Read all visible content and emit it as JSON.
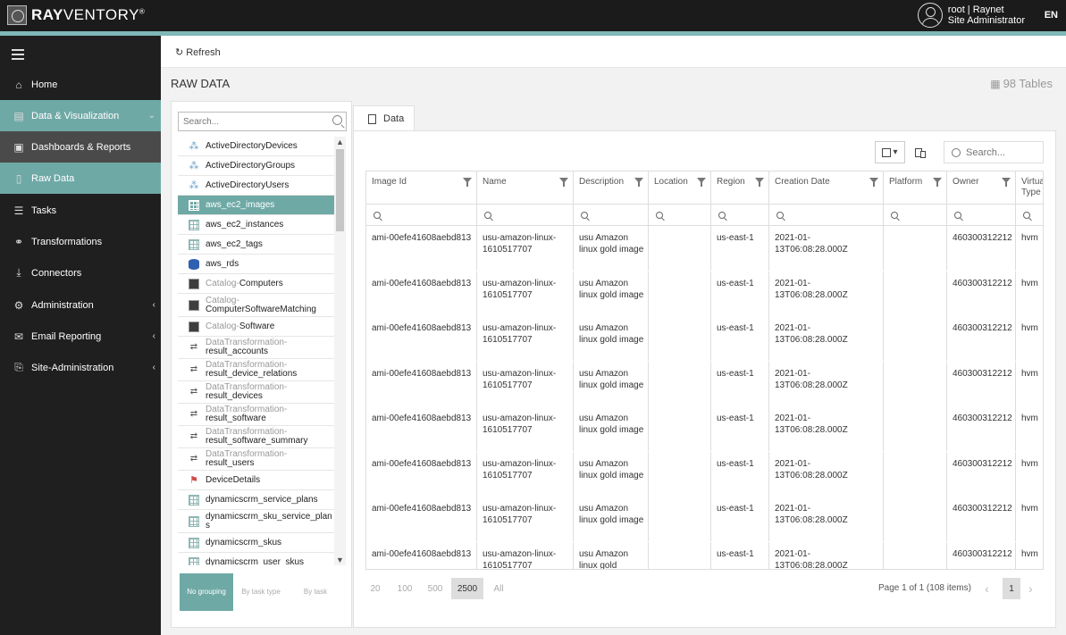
{
  "app": {
    "brand_bold": "RAY",
    "brand_light": "VENTORY",
    "brand_reg": "®",
    "user_line1": "root | Raynet",
    "user_line2": "Site Administrator",
    "lang": "EN"
  },
  "sidebar": {
    "items": [
      {
        "label": "Home",
        "icon": "home-icon"
      },
      {
        "label": "Data & Visualization",
        "icon": "chart-icon"
      },
      {
        "label": "Dashboards & Reports",
        "icon": "dashboard-icon"
      },
      {
        "label": "Raw Data",
        "icon": "document-icon"
      },
      {
        "label": "Tasks",
        "icon": "list-icon"
      },
      {
        "label": "Transformations",
        "icon": "transform-icon"
      },
      {
        "label": "Connectors",
        "icon": "download-icon"
      },
      {
        "label": "Administration",
        "icon": "user-gear-icon"
      },
      {
        "label": "Email Reporting",
        "icon": "mail-icon"
      },
      {
        "label": "Site-Administration",
        "icon": "site-icon"
      }
    ]
  },
  "toolbar": {
    "refresh_label": "Refresh"
  },
  "page": {
    "title": "RAW DATA",
    "tables_count": "98 Tables"
  },
  "table_list": {
    "search_placeholder": "Search...",
    "items": [
      {
        "pre": "",
        "label": "ActiveDirectoryDevices",
        "icon": "tree"
      },
      {
        "pre": "",
        "label": "ActiveDirectoryGroups",
        "icon": "tree"
      },
      {
        "pre": "",
        "label": "ActiveDirectoryUsers",
        "icon": "tree"
      },
      {
        "pre": "",
        "label": "aws_ec2_images",
        "icon": "grid"
      },
      {
        "pre": "",
        "label": "aws_ec2_instances",
        "icon": "grid"
      },
      {
        "pre": "",
        "label": "aws_ec2_tags",
        "icon": "grid"
      },
      {
        "pre": "",
        "label": "aws_rds",
        "icon": "db"
      },
      {
        "pre": "Catalog-",
        "label": "Computers",
        "icon": "cat"
      },
      {
        "pre": "Catalog-",
        "label": "ComputerSoftwareMatching",
        "icon": "cat"
      },
      {
        "pre": "Catalog-",
        "label": "Software",
        "icon": "cat"
      },
      {
        "pre": "DataTransformation-",
        "label": "result_accounts",
        "icon": "link"
      },
      {
        "pre": "DataTransformation-",
        "label": "result_device_relations",
        "icon": "link"
      },
      {
        "pre": "DataTransformation-",
        "label": "result_devices",
        "icon": "link"
      },
      {
        "pre": "DataTransformation-",
        "label": "result_software",
        "icon": "link"
      },
      {
        "pre": "DataTransformation-",
        "label": "result_software_summary",
        "icon": "link"
      },
      {
        "pre": "DataTransformation-",
        "label": "result_users",
        "icon": "link"
      },
      {
        "pre": "",
        "label": "DeviceDetails",
        "icon": "flag"
      },
      {
        "pre": "",
        "label": "dynamicscrm_service_plans",
        "icon": "grid"
      },
      {
        "pre": "",
        "label": "dynamicscrm_sku_service_plan s",
        "icon": "grid"
      },
      {
        "pre": "",
        "label": "dynamicscrm_skus",
        "icon": "grid"
      },
      {
        "pre": "",
        "label": "dynamicscrm_user_skus",
        "icon": "grid"
      }
    ],
    "grouping": {
      "no": "No grouping",
      "task_type": "By task type",
      "task": "By task"
    }
  },
  "grid": {
    "tab_label": "Data",
    "search_placeholder": "Search...",
    "columns": [
      "Image Id",
      "Name",
      "Description",
      "Location",
      "Region",
      "Creation Date",
      "Platform",
      "Owner",
      "Virtual Type"
    ],
    "rows": [
      [
        "ami-00efe41608aebd813",
        "usu-amazon-linux-1610517707",
        "usu Amazon linux gold image",
        "",
        "us-east-1",
        "2021-01-13T06:08:28.000Z",
        "",
        "460300312212",
        "hvm"
      ],
      [
        "ami-00efe41608aebd813",
        "usu-amazon-linux-1610517707",
        "usu Amazon linux gold image",
        "",
        "us-east-1",
        "2021-01-13T06:08:28.000Z",
        "",
        "460300312212",
        "hvm"
      ],
      [
        "ami-00efe41608aebd813",
        "usu-amazon-linux-1610517707",
        "usu Amazon linux gold image",
        "",
        "us-east-1",
        "2021-01-13T06:08:28.000Z",
        "",
        "460300312212",
        "hvm"
      ],
      [
        "ami-00efe41608aebd813",
        "usu-amazon-linux-1610517707",
        "usu Amazon linux gold image",
        "",
        "us-east-1",
        "2021-01-13T06:08:28.000Z",
        "",
        "460300312212",
        "hvm"
      ],
      [
        "ami-00efe41608aebd813",
        "usu-amazon-linux-1610517707",
        "usu Amazon linux gold image",
        "",
        "us-east-1",
        "2021-01-13T06:08:28.000Z",
        "",
        "460300312212",
        "hvm"
      ],
      [
        "ami-00efe41608aebd813",
        "usu-amazon-linux-1610517707",
        "usu Amazon linux gold image",
        "",
        "us-east-1",
        "2021-01-13T06:08:28.000Z",
        "",
        "460300312212",
        "hvm"
      ],
      [
        "ami-00efe41608aebd813",
        "usu-amazon-linux-1610517707",
        "usu Amazon linux gold image",
        "",
        "us-east-1",
        "2021-01-13T06:08:28.000Z",
        "",
        "460300312212",
        "hvm"
      ],
      [
        "ami-00efe41608aebd813",
        "usu-amazon-linux-1610517707",
        "usu Amazon linux gold",
        "",
        "us-east-1",
        "2021-01-13T06:08:28.000Z",
        "",
        "460300312212",
        "hvm"
      ]
    ],
    "page_sizes": [
      "20",
      "100",
      "500",
      "2500",
      "All"
    ],
    "page_size_selected": "2500",
    "page_info": "Page 1 of 1 (108 items)",
    "current_page": "1"
  },
  "colors": {
    "accent": "#6fa9a6",
    "sidebar_bg": "#1f1f1f",
    "topbar_bg": "#1b1b1b"
  }
}
